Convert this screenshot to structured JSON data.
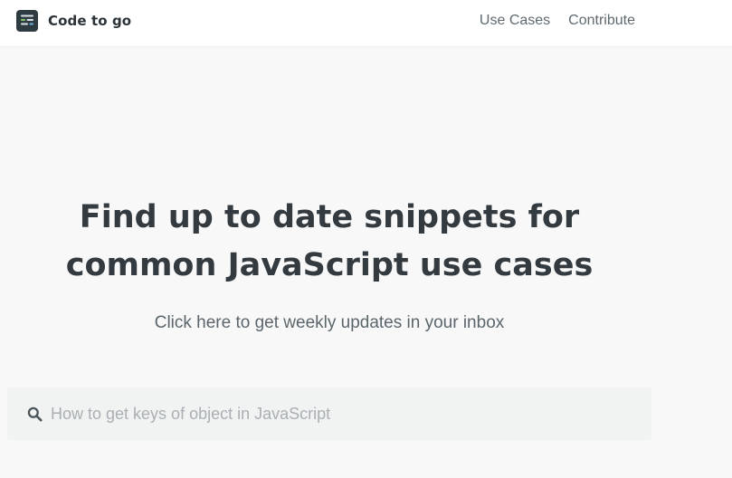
{
  "header": {
    "brand_name": "Code to go",
    "logo_icon": "code-lines-icon",
    "nav": [
      {
        "label": "Use Cases"
      },
      {
        "label": "Contribute"
      }
    ]
  },
  "hero": {
    "title_line1": "Find up to date snippets for",
    "title_line2": "common JavaScript use cases",
    "subtitle": "Click here to get weekly updates in your inbox"
  },
  "search": {
    "icon": "search-icon",
    "placeholder": "How to get keys of object in JavaScript",
    "value": ""
  },
  "colors": {
    "page_background": "#f8f8f8",
    "header_background": "#ffffff",
    "text_dark": "#333a40",
    "text_muted": "#5b666c",
    "placeholder": "#a9b0b4",
    "search_background": "#f1f2f2",
    "logo_background": "#2e3b40",
    "logo_accent_green": "#7ec96b",
    "logo_accent_blue": "#6cb6e8"
  }
}
